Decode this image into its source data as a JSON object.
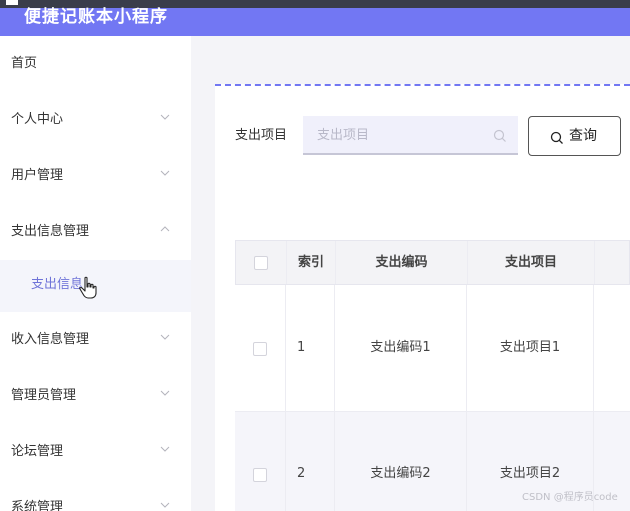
{
  "app": {
    "title": "便捷记账本小程序"
  },
  "sidebar": {
    "items": [
      {
        "label": "首页",
        "chevron": "none"
      },
      {
        "label": "个人中心",
        "chevron": "down"
      },
      {
        "label": "用户管理",
        "chevron": "down"
      },
      {
        "label": "支出信息管理",
        "chevron": "up"
      },
      {
        "label": "收入信息管理",
        "chevron": "down"
      },
      {
        "label": "管理员管理",
        "chevron": "down"
      },
      {
        "label": "论坛管理",
        "chevron": "down"
      },
      {
        "label": "系统管理",
        "chevron": "down"
      }
    ],
    "sub_item": {
      "label": "支出信息"
    }
  },
  "search": {
    "label": "支出项目",
    "placeholder": "支出项目",
    "value": "",
    "button_label": "查询"
  },
  "table": {
    "columns": [
      "索引",
      "支出编码",
      "支出项目"
    ],
    "rows": [
      {
        "index": "1",
        "code": "支出编码1",
        "item": "支出项目1"
      },
      {
        "index": "2",
        "code": "支出编码2",
        "item": "支出项目2"
      }
    ]
  },
  "watermark": "CSDN @程序员code",
  "colors": {
    "accent": "#7277f3",
    "active_text": "#6f74d8"
  }
}
